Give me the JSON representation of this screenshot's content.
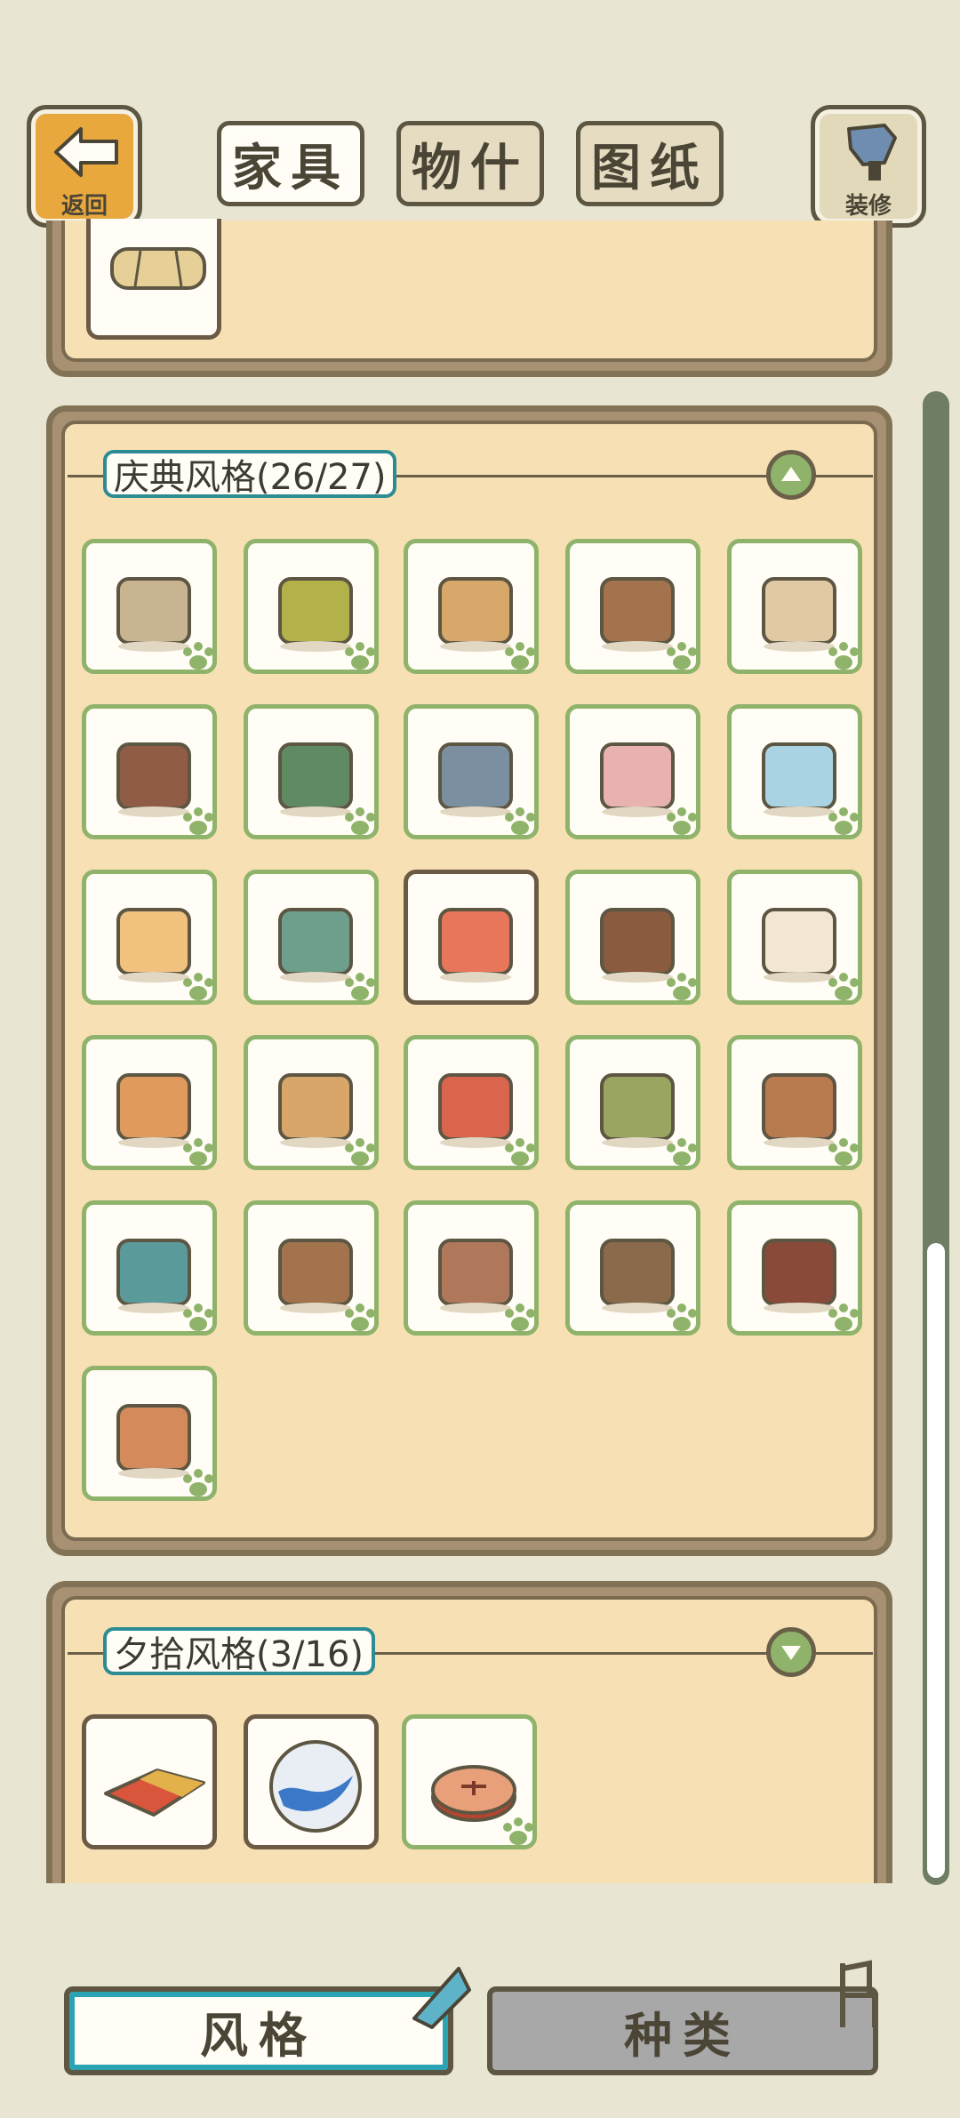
{
  "header": {
    "back_label": "返回",
    "decorate_label": "装修",
    "tabs": [
      {
        "label": "家具",
        "active": true
      },
      {
        "label": "物什",
        "active": false
      },
      {
        "label": "图纸",
        "active": false
      }
    ]
  },
  "sections": [
    {
      "title": "庆典风格(26/27)",
      "expanded": true,
      "icon": "chevron-up-icon"
    },
    {
      "title": "夕拾风格(3/16)",
      "expanded": false,
      "icon": "chevron-down-icon"
    }
  ],
  "celebration_items": [
    "wooden-wall-wallpaper-item",
    "grass-floor-item",
    "ladder-item",
    "wooden-barrels-item",
    "arched-window-item",
    "wooden-door-item",
    "green-sleeping-bag-item",
    "mirror-tray-item",
    "bed-item",
    "glass-vase-item",
    "photo-wall-item",
    "green-suitcase-item",
    "candy-item",
    "fireplace-cabinet-item",
    "hourglass-item",
    "gift-box-item",
    "round-stool-item",
    "red-mushroom-stool-item",
    "rolled-mats-item",
    "kitchen-stove-item",
    "watering-can-item",
    "easel-mirror-item",
    "coat-rack-item",
    "wooden-fence-item",
    "wooden-cabinet-item",
    "sack-bags-item"
  ],
  "memory_items": [
    "rug-item",
    "marble-item",
    "round-badge-item"
  ],
  "bottom_tabs": [
    {
      "label": "风格",
      "active": true
    },
    {
      "label": "种类",
      "active": false
    }
  ],
  "colors": {
    "background": "#e8e6d3",
    "panel": "#f7e0b3",
    "owned_border": "#8fb36a",
    "accent": "#2aa3b3",
    "back_button": "#e8a83e"
  }
}
